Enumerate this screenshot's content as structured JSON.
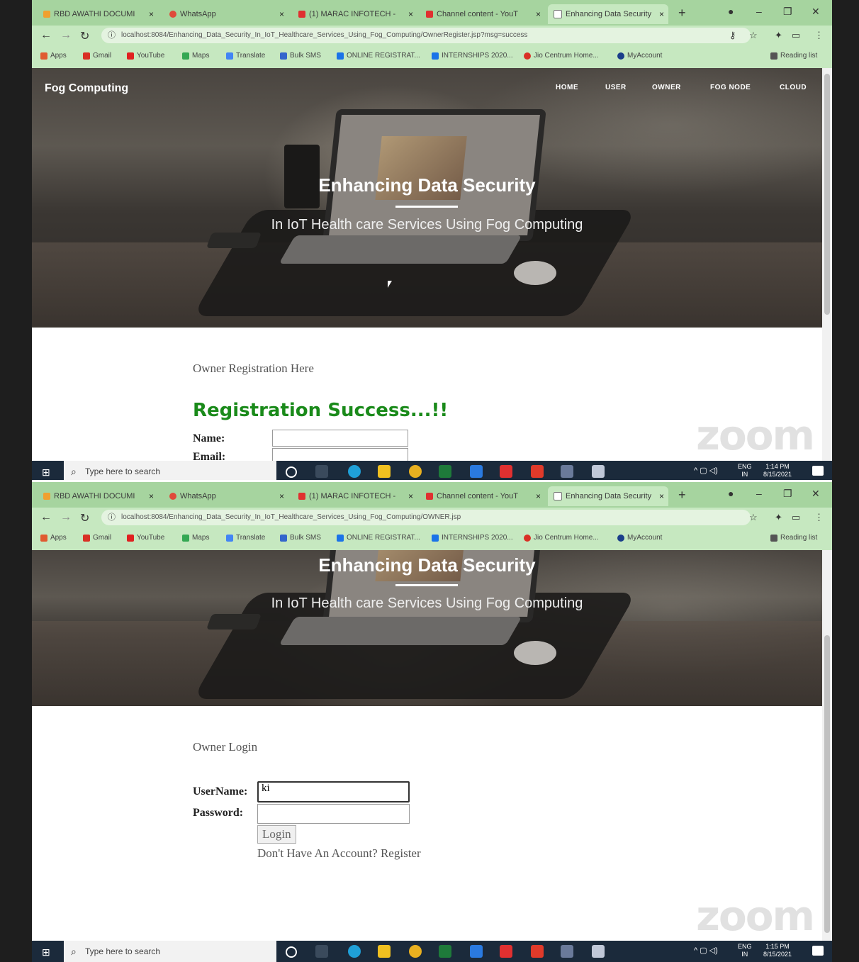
{
  "browser": {
    "tabs": [
      {
        "title": "RBD AWATHI DOCUMI",
        "color": "#f0a030"
      },
      {
        "title": "WhatsApp",
        "color": "#e04a3a"
      },
      {
        "title": "(1) MARAC INFOTECH -",
        "color": "#e03030"
      },
      {
        "title": "Channel content - YouT",
        "color": "#e03030"
      },
      {
        "title": "Enhancing Data Security",
        "color": "#777777"
      }
    ],
    "new_tab": "+",
    "bookmarks": [
      {
        "label": "Apps",
        "color": "#e05a30"
      },
      {
        "label": "Gmail",
        "color": "#d93025"
      },
      {
        "label": "YouTube",
        "color": "#e02020"
      },
      {
        "label": "Maps",
        "color": "#34a853"
      },
      {
        "label": "Translate",
        "color": "#4285f4"
      },
      {
        "label": "Bulk SMS",
        "color": "#3366cc"
      },
      {
        "label": "ONLINE REGISTRAT...",
        "color": "#1a73e8"
      },
      {
        "label": "INTERNSHIPS 2020...",
        "color": "#1a73e8"
      },
      {
        "label": "Jio Centrum Home...",
        "color": "#d93025"
      },
      {
        "label": "MyAccount",
        "color": "#1a3e8a"
      }
    ],
    "reading_list": "Reading list"
  },
  "shot1": {
    "url": "localhost:8084/Enhancing_Data_Security_In_IoT_Healthcare_Services_Using_Fog_Computing/OwnerRegister.jsp?msg=success",
    "section_title": "Owner Registration Here",
    "success_message": "Registration Success...!!",
    "fields": [
      {
        "label": "Name:"
      },
      {
        "label": "Email:"
      }
    ],
    "clock": {
      "time": "1:14 PM",
      "date": "8/15/2021"
    }
  },
  "shot2": {
    "url": "localhost:8084/Enhancing_Data_Security_In_IoT_Healthcare_Services_Using_Fog_Computing/OWNER.jsp",
    "section_title": "Owner Login",
    "username_label": "UserName:",
    "username_value": "ki",
    "password_label": "Password:",
    "login_button": "Login",
    "register_link": "Don't Have An Account? Register",
    "clock": {
      "time": "1:15 PM",
      "date": "8/15/2021"
    }
  },
  "site": {
    "brand": "Fog Computing",
    "nav": [
      "HOME",
      "USER",
      "OWNER",
      "FOG NODE",
      "CLOUD"
    ],
    "hero_title": "Enhancing Data Security",
    "hero_subtitle": "In IoT Health care Services Using Fog Computing"
  },
  "taskbar": {
    "search_placeholder": "Type here to search",
    "lang": "ENG",
    "region": "IN"
  },
  "watermark": "zoom"
}
